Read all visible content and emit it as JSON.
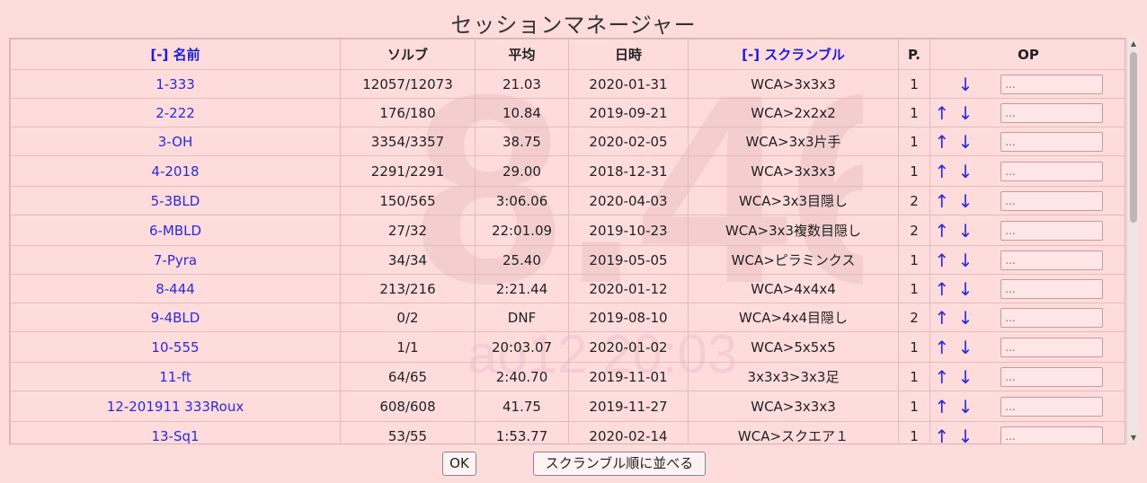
{
  "dialog": {
    "title": "セッションマネージャー",
    "ok_label": "OK",
    "sort_label": "スクランブル順に並べる"
  },
  "watermark": {
    "big": "8.46",
    "small": "ao12 20:03"
  },
  "columns": {
    "name": "[-] 名前",
    "solves": "ソルブ",
    "avg": "平均",
    "date": "日時",
    "scramble": "[-] スクランブル",
    "p": "P.",
    "op": "OP"
  },
  "rows": [
    {
      "name": "1-333",
      "solves": "12057/12073",
      "avg": "21.03",
      "date": "2020-01-31",
      "scramble": "WCA>3x3x3",
      "p": "1",
      "up": "",
      "down": "↓",
      "op": "..."
    },
    {
      "name": "2-222",
      "solves": "176/180",
      "avg": "10.84",
      "date": "2019-09-21",
      "scramble": "WCA>2x2x2",
      "p": "1",
      "up": "↑",
      "down": "↓",
      "op": "..."
    },
    {
      "name": "3-OH",
      "solves": "3354/3357",
      "avg": "38.75",
      "date": "2020-02-05",
      "scramble": "WCA>3x3片手",
      "p": "1",
      "up": "↑",
      "down": "↓",
      "op": "..."
    },
    {
      "name": "4-2018",
      "solves": "2291/2291",
      "avg": "29.00",
      "date": "2018-12-31",
      "scramble": "WCA>3x3x3",
      "p": "1",
      "up": "↑",
      "down": "↓",
      "op": "..."
    },
    {
      "name": "5-3BLD",
      "solves": "150/565",
      "avg": "3:06.06",
      "date": "2020-04-03",
      "scramble": "WCA>3x3目隠し",
      "p": "2",
      "up": "↑",
      "down": "↓",
      "op": "..."
    },
    {
      "name": "6-MBLD",
      "solves": "27/32",
      "avg": "22:01.09",
      "date": "2019-10-23",
      "scramble": "WCA>3x3複数目隠し",
      "p": "2",
      "up": "↑",
      "down": "↓",
      "op": "..."
    },
    {
      "name": "7-Pyra",
      "solves": "34/34",
      "avg": "25.40",
      "date": "2019-05-05",
      "scramble": "WCA>ピラミンクス",
      "p": "1",
      "up": "↑",
      "down": "↓",
      "op": "..."
    },
    {
      "name": "8-444",
      "solves": "213/216",
      "avg": "2:21.44",
      "date": "2020-01-12",
      "scramble": "WCA>4x4x4",
      "p": "1",
      "up": "↑",
      "down": "↓",
      "op": "..."
    },
    {
      "name": "9-4BLD",
      "solves": "0/2",
      "avg": "DNF",
      "date": "2019-08-10",
      "scramble": "WCA>4x4目隠し",
      "p": "2",
      "up": "↑",
      "down": "↓",
      "op": "..."
    },
    {
      "name": "10-555",
      "solves": "1/1",
      "avg": "20:03.07",
      "date": "2020-01-02",
      "scramble": "WCA>5x5x5",
      "p": "1",
      "up": "↑",
      "down": "↓",
      "op": "..."
    },
    {
      "name": "11-ft",
      "solves": "64/65",
      "avg": "2:40.70",
      "date": "2019-11-01",
      "scramble": "3x3x3>3x3足",
      "p": "1",
      "up": "↑",
      "down": "↓",
      "op": "..."
    },
    {
      "name": "12-201911 333Roux",
      "solves": "608/608",
      "avg": "41.75",
      "date": "2019-11-27",
      "scramble": "WCA>3x3x3",
      "p": "1",
      "up": "↑",
      "down": "↓",
      "op": "..."
    },
    {
      "name": "13-Sq1",
      "solves": "53/55",
      "avg": "1:53.77",
      "date": "2020-02-14",
      "scramble": "WCA>スクエア１",
      "p": "1",
      "up": "↑",
      "down": "↓",
      "op": "..."
    }
  ]
}
